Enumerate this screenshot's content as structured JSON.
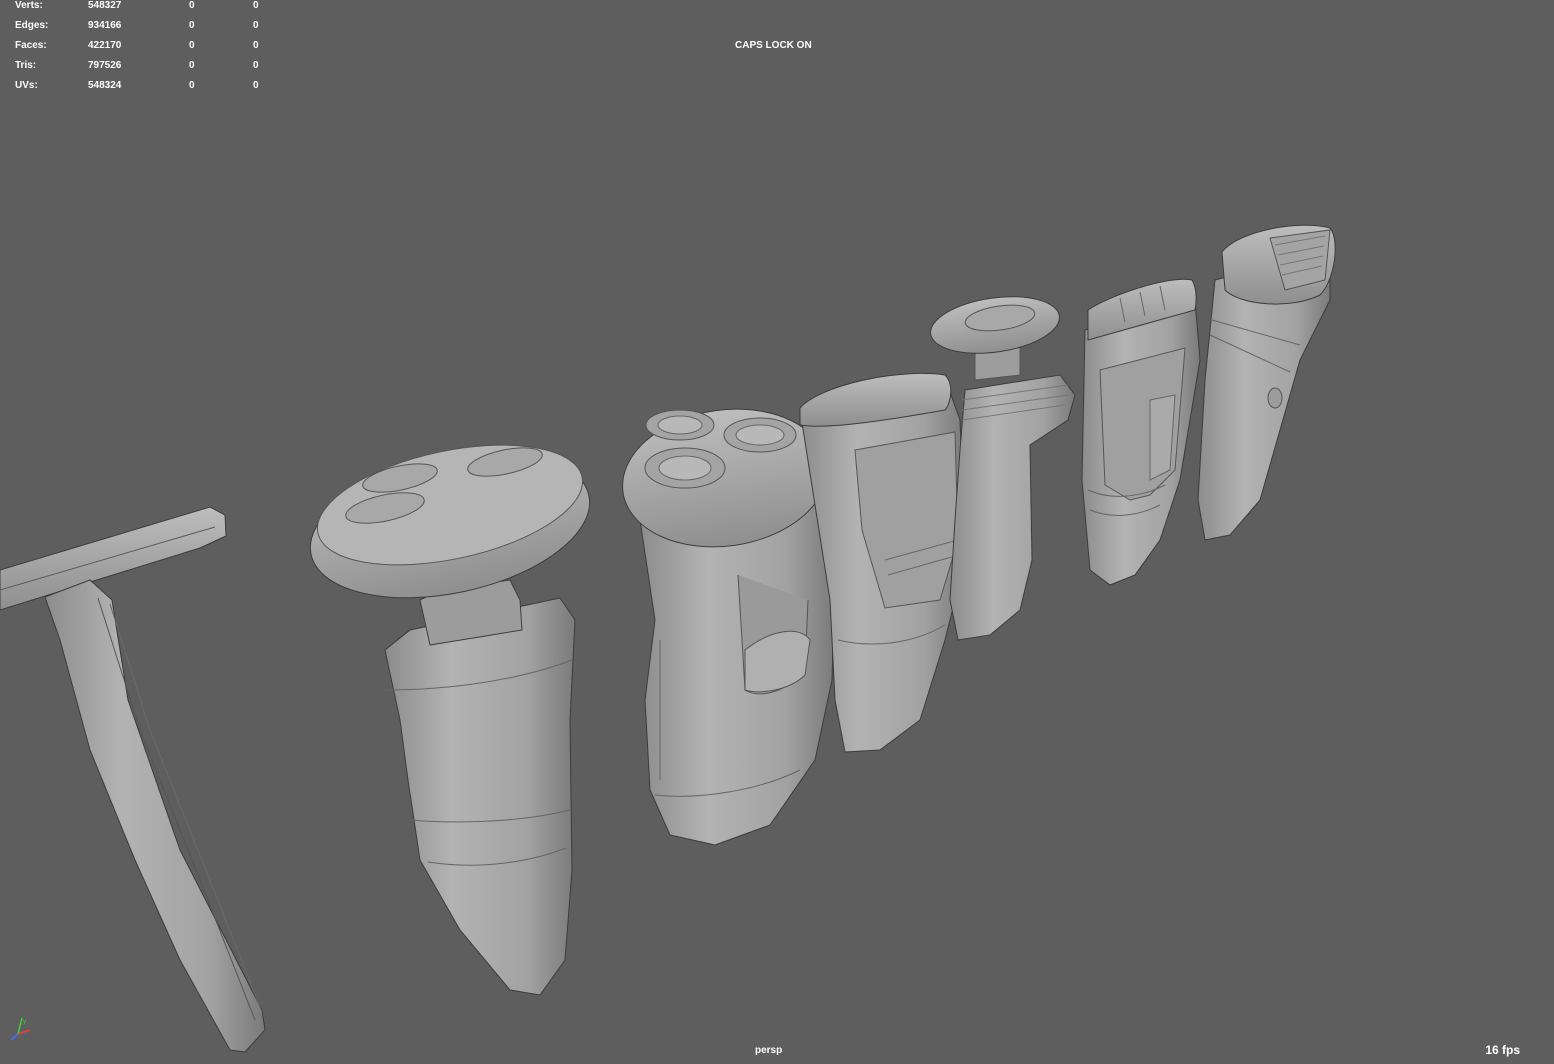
{
  "stats": [
    {
      "label": "Verts:",
      "value": "548327",
      "c1": "0",
      "c2": "0"
    },
    {
      "label": "Edges:",
      "value": "934166",
      "c1": "0",
      "c2": "0"
    },
    {
      "label": "Faces:",
      "value": "422170",
      "c1": "0",
      "c2": "0"
    },
    {
      "label": "Tris:",
      "value": "797526",
      "c1": "0",
      "c2": "0"
    },
    {
      "label": "UVs:",
      "value": "548324",
      "c1": "0",
      "c2": "0"
    }
  ],
  "viewport": {
    "caps_lock": "CAPS LOCK ON",
    "camera": "persp",
    "fps": "16 fps",
    "background_color": "#5e5e5e",
    "model_color": "#a9a9a9"
  },
  "axis_gizmo": {
    "icon": "axis-gizmo-icon",
    "axes": [
      "x",
      "y",
      "z"
    ],
    "x_color": "#e04040",
    "y_color": "#40d040",
    "z_color": "#4070ff"
  },
  "scene_objects": [
    "safety-razor",
    "rotary-shaver-large",
    "rotary-shaver-three-head",
    "foil-shaver-wide",
    "rotary-shaver-slim",
    "foil-shaver-narrow",
    "epilator"
  ]
}
